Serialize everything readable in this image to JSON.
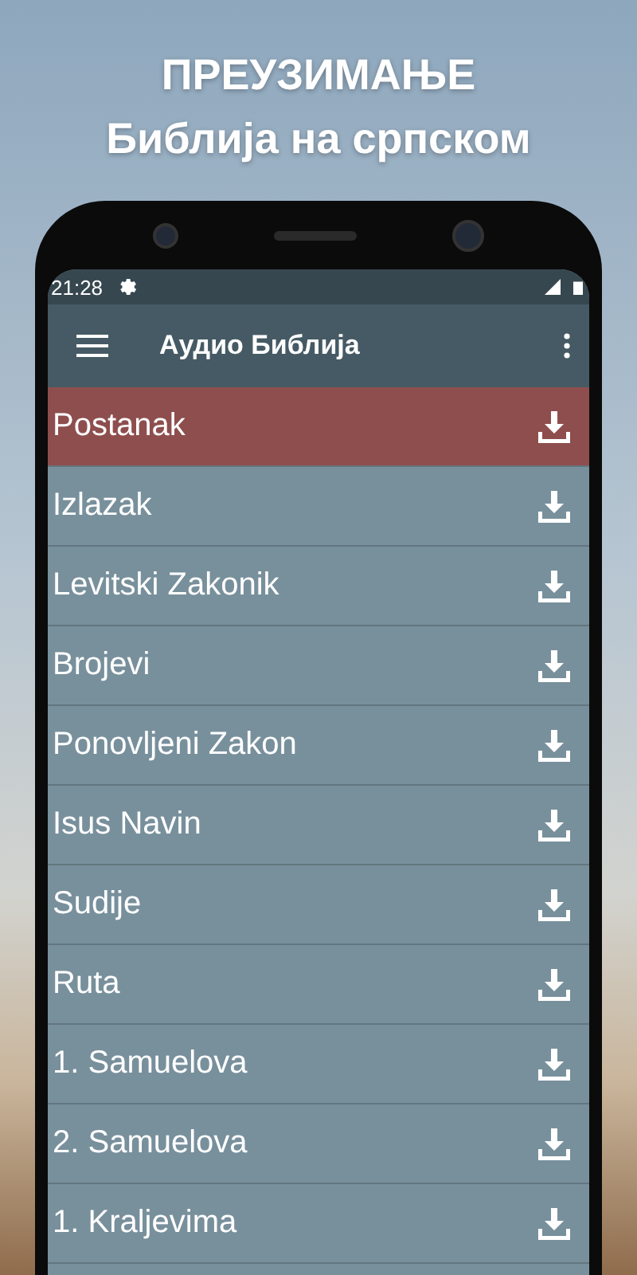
{
  "headline": [
    "ПРЕУЗИМАЊЕ",
    "Библија на српском"
  ],
  "status_bar": {
    "time": "21:28"
  },
  "app_bar": {
    "title": "Аудио Библија"
  },
  "books": [
    {
      "name": "Postanak",
      "selected": true
    },
    {
      "name": "Izlazak",
      "selected": false
    },
    {
      "name": "Levitski Zakonik",
      "selected": false
    },
    {
      "name": "Brojevi",
      "selected": false
    },
    {
      "name": "Ponovljeni Zakon",
      "selected": false
    },
    {
      "name": "Isus Navin",
      "selected": false
    },
    {
      "name": "Sudije",
      "selected": false
    },
    {
      "name": "Ruta",
      "selected": false
    },
    {
      "name": "1. Samuelova",
      "selected": false
    },
    {
      "name": "2. Samuelova",
      "selected": false
    },
    {
      "name": "1. Kraljevima",
      "selected": false
    }
  ]
}
